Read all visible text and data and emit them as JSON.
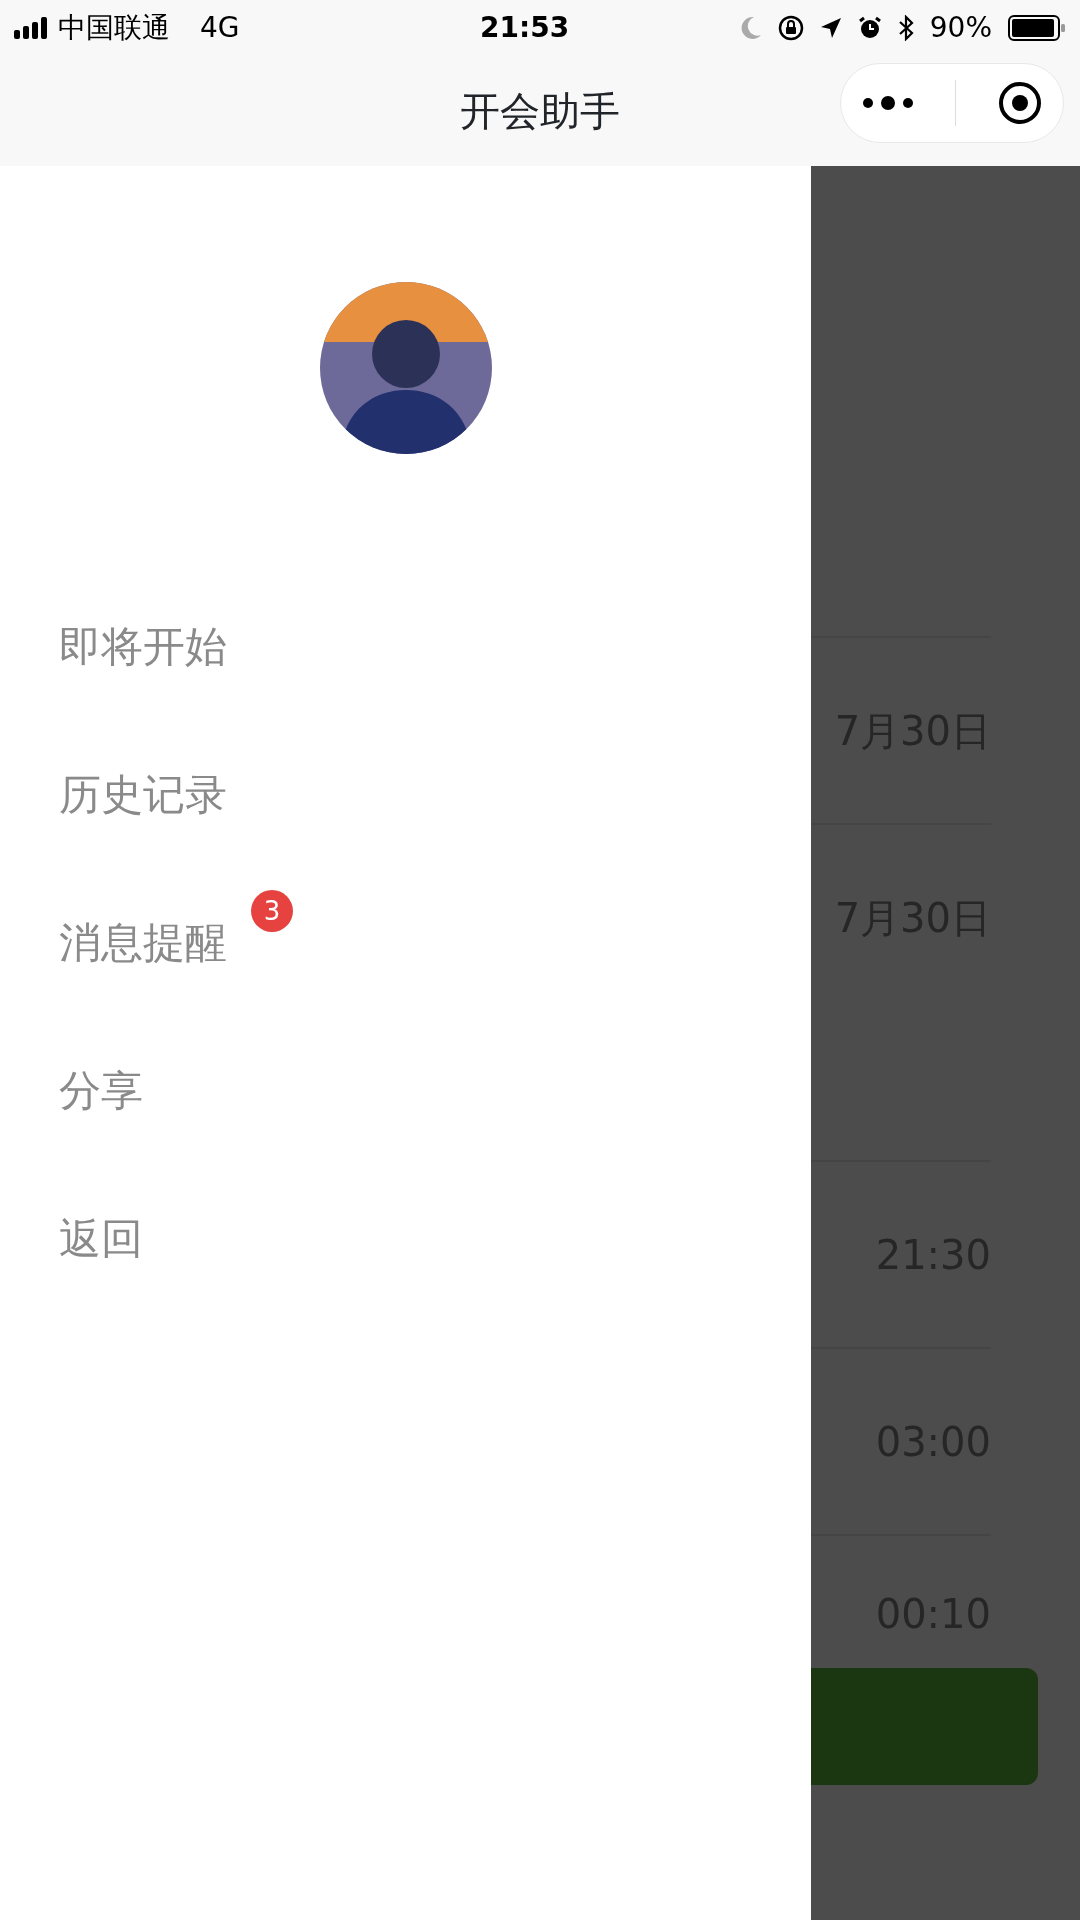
{
  "status_bar": {
    "carrier": "中国联通",
    "network": "4G",
    "time": "21:53",
    "battery": "90%"
  },
  "nav_bar": {
    "title": "开会助手"
  },
  "drawer": {
    "menu": [
      {
        "label": "即将开始"
      },
      {
        "label": "历史记录"
      },
      {
        "label": "消息提醒",
        "badge": "3"
      },
      {
        "label": "分享"
      },
      {
        "label": "返回"
      }
    ]
  },
  "background_list": {
    "rows": [
      {
        "text": "7月30日"
      },
      {
        "text": "7月30日"
      },
      {
        "text": "21:30"
      },
      {
        "text": "03:00"
      },
      {
        "text": "00:10"
      }
    ]
  }
}
